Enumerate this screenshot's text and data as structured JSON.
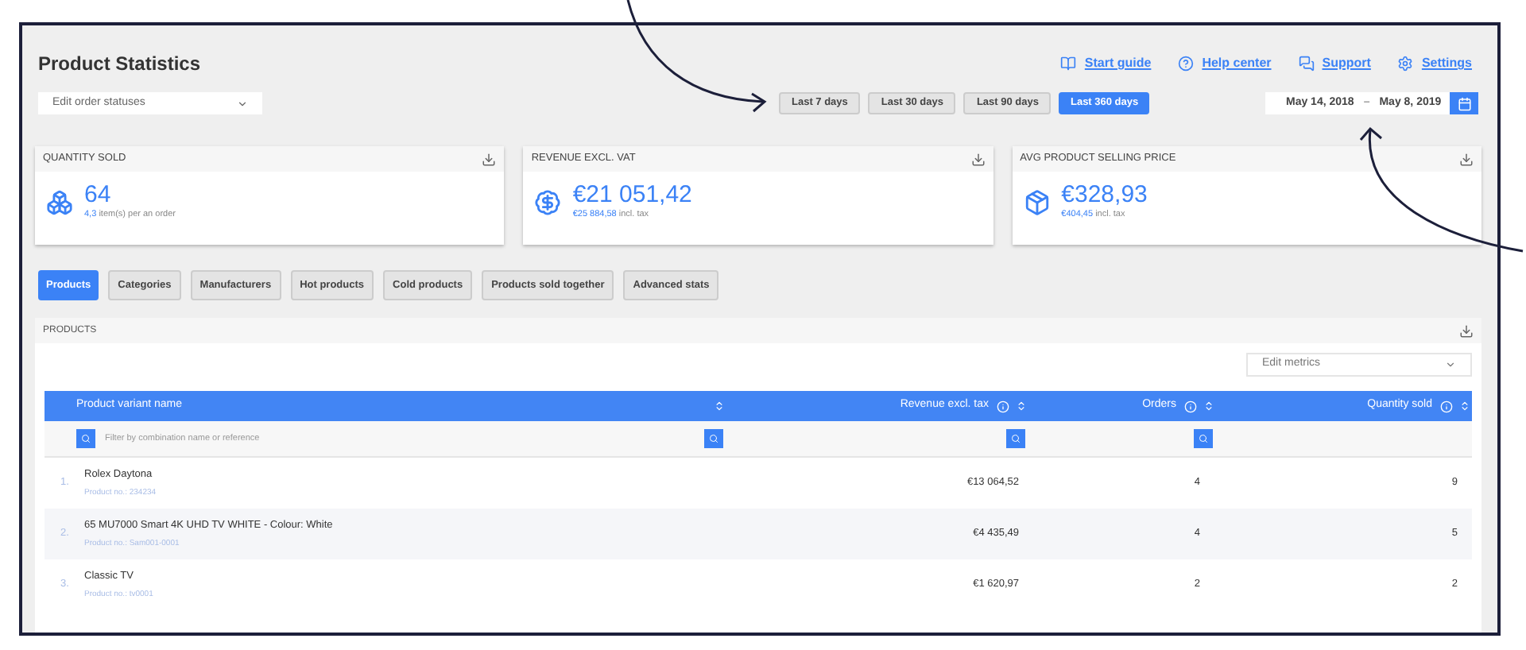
{
  "page": {
    "title": "Product Statistics"
  },
  "nav_links": [
    {
      "kind": "guide",
      "label": "Start guide"
    },
    {
      "kind": "help",
      "label": "Help center"
    },
    {
      "kind": "support",
      "label": "Support"
    },
    {
      "kind": "settings",
      "label": "Settings"
    }
  ],
  "order_status_select": {
    "value": "Edit order statuses"
  },
  "range_buttons": [
    {
      "label": "Last 7 days",
      "selected": false
    },
    {
      "label": "Last 30 days",
      "selected": false
    },
    {
      "label": "Last 90 days",
      "selected": false
    },
    {
      "label": "Last 360 days",
      "selected": true
    }
  ],
  "date_range": {
    "from": "May 14, 2018",
    "separator": "–",
    "to": "May 8, 2019"
  },
  "cards": [
    {
      "kind": "quantity",
      "title": "QUANTITY SOLD",
      "value": "64",
      "sub_value": "4,3",
      "sub_text": "item(s) per an order"
    },
    {
      "kind": "revenue",
      "title": "REVENUE EXCL. VAT",
      "value": "€21 051,42",
      "sub_value": "€25 884,58",
      "sub_text": "incl. tax"
    },
    {
      "kind": "price",
      "title": "AVG PRODUCT SELLING PRICE",
      "value": "€328,93",
      "sub_value": "€404,45",
      "sub_text": "incl. tax"
    }
  ],
  "tabs": [
    {
      "label": "Products",
      "selected": true
    },
    {
      "label": "Categories",
      "selected": false
    },
    {
      "label": "Manufacturers",
      "selected": false
    },
    {
      "label": "Hot products",
      "selected": false
    },
    {
      "label": "Cold products",
      "selected": false
    },
    {
      "label": "Products sold together",
      "selected": false
    },
    {
      "label": "Advanced stats",
      "selected": false
    }
  ],
  "products_panel": {
    "title": "PRODUCTS",
    "metrics_select": {
      "value": "Edit metrics"
    },
    "table": {
      "columns": [
        {
          "label": "Product variant name",
          "info": false
        },
        {
          "label": "Revenue excl. tax",
          "info": true
        },
        {
          "label": "Orders",
          "info": true
        },
        {
          "label": "Quantity sold",
          "info": true
        }
      ],
      "filter_placeholder": "Filter by combination name or reference",
      "rows": [
        {
          "index": "1.",
          "name": "Rolex Daytona",
          "reference": "Product no.: 234234",
          "revenue": "€13 064,52",
          "orders": "4",
          "quantity": "9"
        },
        {
          "index": "2.",
          "name": "65 MU7000 Smart 4K UHD TV WHITE - Colour: White",
          "reference": "Product no.: Sam001-0001",
          "revenue": "€4 435,49",
          "orders": "4",
          "quantity": "5"
        },
        {
          "index": "3.",
          "name": "Classic TV",
          "reference": "Product no.: tv0001",
          "revenue": "€1 620,97",
          "orders": "2",
          "quantity": "2"
        }
      ]
    }
  }
}
